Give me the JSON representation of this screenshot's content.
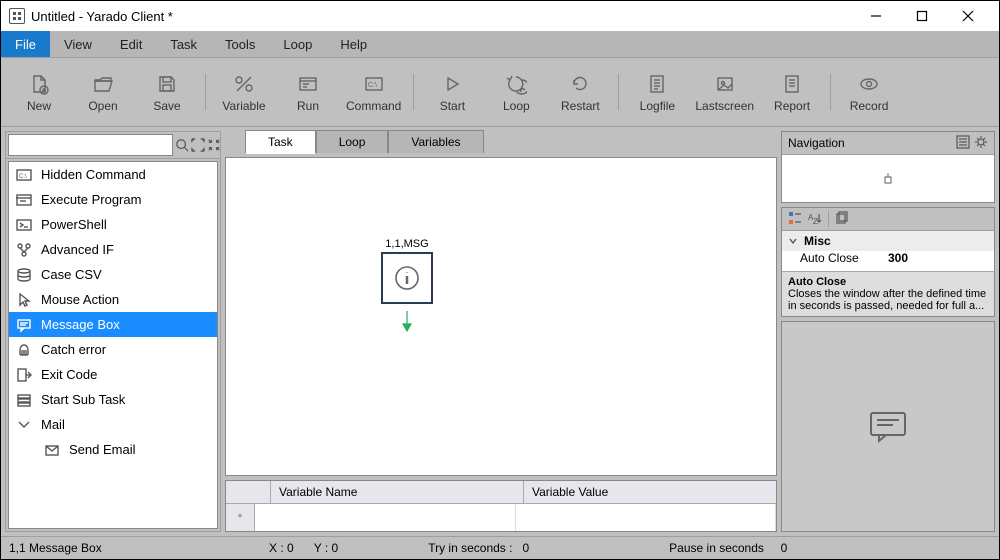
{
  "title": "Untitled  - Yarado Client *",
  "menus": [
    "File",
    "View",
    "Edit",
    "Task",
    "Tools",
    "Loop",
    "Help"
  ],
  "active_menu_index": 0,
  "toolbar": [
    {
      "label": "New",
      "icon": "new-icon"
    },
    {
      "label": "Open",
      "icon": "open-icon"
    },
    {
      "label": "Save",
      "icon": "save-icon"
    },
    {
      "sep": true
    },
    {
      "label": "Variable",
      "icon": "variable-icon"
    },
    {
      "label": "Run",
      "icon": "run-icon"
    },
    {
      "label": "Command",
      "icon": "command-icon"
    },
    {
      "sep": true
    },
    {
      "label": "Start",
      "icon": "start-icon"
    },
    {
      "label": "Loop",
      "icon": "loop-icon"
    },
    {
      "label": "Restart",
      "icon": "restart-icon"
    },
    {
      "sep": true
    },
    {
      "label": "Logfile",
      "icon": "logfile-icon"
    },
    {
      "label": "Lastscreen",
      "icon": "lastscreen-icon"
    },
    {
      "label": "Report",
      "icon": "report-icon"
    },
    {
      "sep": true
    },
    {
      "label": "Record",
      "icon": "record-icon"
    }
  ],
  "tree": [
    {
      "label": "Hidden Command",
      "icon": "cmd"
    },
    {
      "label": "Execute Program",
      "icon": "exec"
    },
    {
      "label": "PowerShell",
      "icon": "ps"
    },
    {
      "label": "Advanced IF",
      "icon": "if"
    },
    {
      "label": "Case CSV",
      "icon": "csv"
    },
    {
      "label": "Mouse Action",
      "icon": "mouse"
    },
    {
      "label": "Message Box",
      "icon": "msg",
      "selected": true
    },
    {
      "label": "Catch error",
      "icon": "catch"
    },
    {
      "label": "Exit Code",
      "icon": "exit"
    },
    {
      "label": "Start Sub Task",
      "icon": "sub"
    },
    {
      "label": "Mail",
      "icon": "mail"
    },
    {
      "label": "Send Email",
      "icon": "send",
      "indent": true
    }
  ],
  "canvas_tabs": [
    "Task",
    "Loop",
    "Variables"
  ],
  "active_canvas_tab": 0,
  "node": {
    "label": "1,1,MSG"
  },
  "var_headers": {
    "name": "Variable Name",
    "value": "Variable Value",
    "row": "*"
  },
  "navigation": {
    "title": "Navigation"
  },
  "properties": {
    "category": "Misc",
    "rows": [
      {
        "name": "Auto Close",
        "value": "300"
      }
    ],
    "desc_title": "Auto Close",
    "desc_body": "Closes the window after the defined time in seconds is passed, needed for full a..."
  },
  "status": {
    "step": "1,1 Message Box",
    "x_label": "X :",
    "x": "0",
    "y_label": "Y :",
    "y": "0",
    "try_label": "Try in seconds :",
    "try": "0",
    "pause_label": "Pause in seconds",
    "pause": "0"
  }
}
